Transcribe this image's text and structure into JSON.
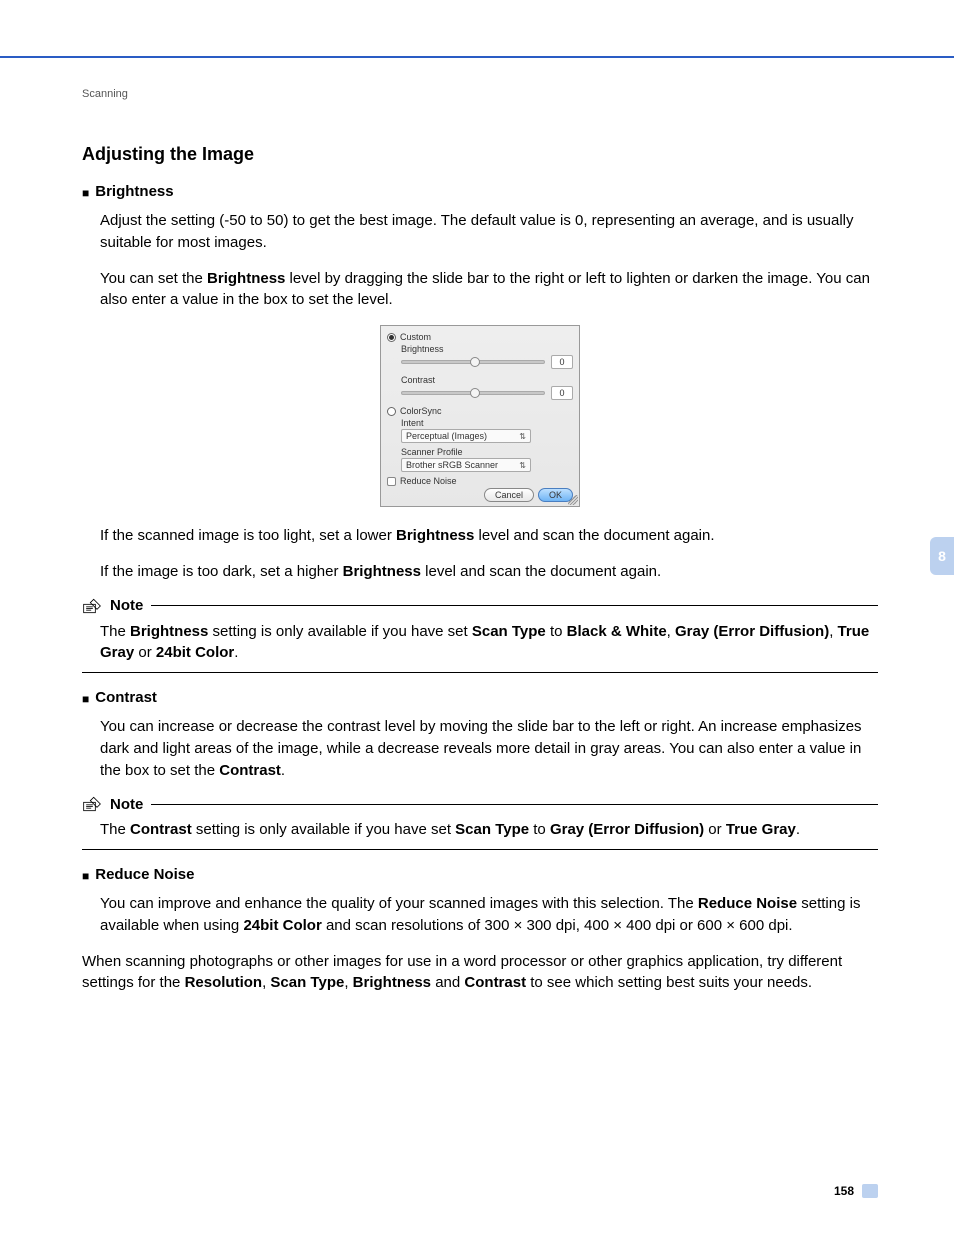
{
  "header": {
    "breadcrumb": "Scanning"
  },
  "title": "Adjusting the Image",
  "brightness": {
    "heading": "Brightness",
    "p1": "Adjust the setting (-50 to 50) to get the best image. The default value is 0, representing an average, and is usually suitable for most images.",
    "p2_a": "You can set the ",
    "p2_b": "Brightness",
    "p2_c": " level by dragging the slide bar to the right or left to lighten or darken the image. You can also enter a value in the box to set the level.",
    "p3_a": "If the scanned image is too light, set a lower ",
    "p3_b": "Brightness",
    "p3_c": " level and scan the document again.",
    "p4_a": "If the image is too dark, set a higher ",
    "p4_b": "Brightness",
    "p4_c": " level and scan the document again."
  },
  "dialog": {
    "custom_label": "Custom",
    "brightness_label": "Brightness",
    "brightness_value": "0",
    "contrast_label": "Contrast",
    "contrast_value": "0",
    "colorsync_label": "ColorSync",
    "intent_label": "Intent",
    "intent_value": "Perceptual (Images)",
    "profile_label": "Scanner Profile",
    "profile_value": "Brother sRGB Scanner",
    "reduce_noise_label": "Reduce Noise",
    "cancel": "Cancel",
    "ok": "OK"
  },
  "note1": {
    "label": "Note",
    "t1": "The ",
    "t2": "Brightness",
    "t3": " setting is only available if you have set ",
    "t4": "Scan Type",
    "t5": " to ",
    "t6": "Black & White",
    "t7": ", ",
    "t8": "Gray (Error Diffusion)",
    "t9": ", ",
    "t10": "True Gray",
    "t11": " or ",
    "t12": "24bit Color",
    "t13": "."
  },
  "contrast": {
    "heading": "Contrast",
    "p1_a": "You can increase or decrease the contrast level by moving the slide bar to the left or right. An increase emphasizes dark and light areas of the image, while a decrease reveals more detail in gray areas. You can also enter a value in the box to set the ",
    "p1_b": "Contrast",
    "p1_c": "."
  },
  "note2": {
    "label": "Note",
    "t1": "The ",
    "t2": "Contrast",
    "t3": " setting is only available if you have set ",
    "t4": "Scan Type",
    "t5": " to ",
    "t6": "Gray (Error Diffusion)",
    "t7": " or ",
    "t8": "True Gray",
    "t9": "."
  },
  "reduce": {
    "heading": "Reduce Noise",
    "p1_a": "You can improve and enhance the quality of your scanned images with this selection. The ",
    "p1_b": "Reduce Noise",
    "p1_c": " setting is available when using ",
    "p1_d": "24bit Color",
    "p1_e": " and scan resolutions of 300 × 300 dpi, 400 × 400 dpi or 600 × 600 dpi."
  },
  "closing": {
    "t1": "When scanning photographs or other images for use in a word processor or other graphics application, try different settings for the ",
    "t2": "Resolution",
    "t3": ", ",
    "t4": "Scan Type",
    "t5": ", ",
    "t6": "Brightness",
    "t7": " and ",
    "t8": "Contrast",
    "t9": " to see which setting best suits your needs."
  },
  "side": {
    "chapter": "8"
  },
  "footer": {
    "page": "158"
  }
}
